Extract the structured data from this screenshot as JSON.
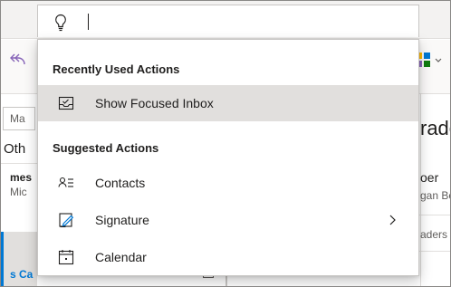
{
  "mail_list": {
    "search_placeholder": "Ma",
    "tab_other": "Oth",
    "sender": "mes",
    "subject": "Mic",
    "selected_item": "s Ca"
  },
  "reading_pane": {
    "title": "rade",
    "from": "oer",
    "to": "gan Bo",
    "snippet": "aders"
  },
  "dropdown": {
    "recent_heading": "Recently Used Actions",
    "recent_items": [
      {
        "label": "Show Focused Inbox",
        "icon": "focused-inbox-icon",
        "highlighted": true
      }
    ],
    "suggested_heading": "Suggested Actions",
    "suggested_items": [
      {
        "label": "Contacts",
        "icon": "contacts-icon",
        "has_submenu": false
      },
      {
        "label": "Signature",
        "icon": "signature-icon",
        "has_submenu": true
      },
      {
        "label": "Calendar",
        "icon": "calendar-icon",
        "has_submenu": false
      }
    ]
  },
  "colors": {
    "accent": "#0078d4",
    "undo_purple": "#8764b8",
    "highlight": "#e1dfdd"
  }
}
